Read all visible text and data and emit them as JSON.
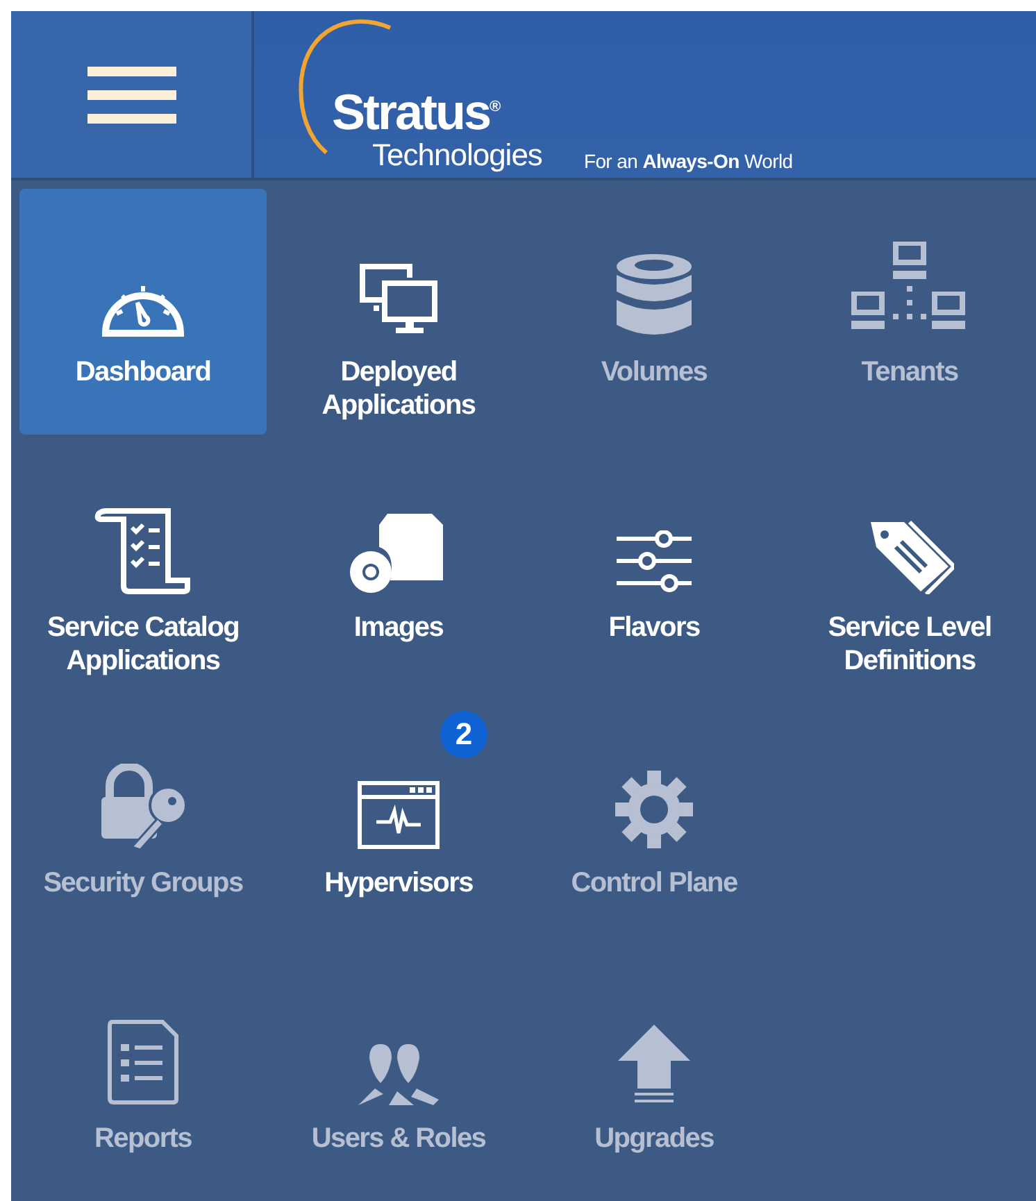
{
  "header": {
    "logo": {
      "name": "Stratus",
      "sub": "Technologies",
      "mark": "®"
    },
    "tagline": "For an **Always-On** World"
  },
  "menu_rows": [
    {
      "items": [
        {
          "label": "Dashboard",
          "selected": true,
          "disabled": false
        },
        {
          "label": "Deployed Applications",
          "selected": false,
          "disabled": false
        },
        {
          "label": "Volumes",
          "selected": false,
          "disabled": true
        },
        {
          "label": "Tenants",
          "selected": false,
          "disabled": true
        }
      ]
    },
    {
      "items": [
        {
          "label": "Service Catalog Applications",
          "selected": false,
          "disabled": false
        },
        {
          "label": "Images",
          "selected": false,
          "disabled": false
        },
        {
          "label": "Flavors",
          "selected": false,
          "disabled": false
        },
        {
          "label": "Service Level Definitions",
          "selected": false,
          "disabled": false
        }
      ]
    },
    {
      "items": [
        {
          "label": "Security Groups",
          "selected": false,
          "disabled": true
        },
        {
          "label": "Hypervisors",
          "selected": false,
          "disabled": false,
          "badge": "2"
        },
        {
          "label": "Control Plane",
          "selected": false,
          "disabled": true
        }
      ]
    },
    {
      "items": [
        {
          "label": "Reports",
          "selected": false,
          "disabled": true
        },
        {
          "label": "Users & Roles",
          "selected": false,
          "disabled": true
        },
        {
          "label": "Upgrades",
          "selected": false,
          "disabled": true
        }
      ]
    }
  ]
}
